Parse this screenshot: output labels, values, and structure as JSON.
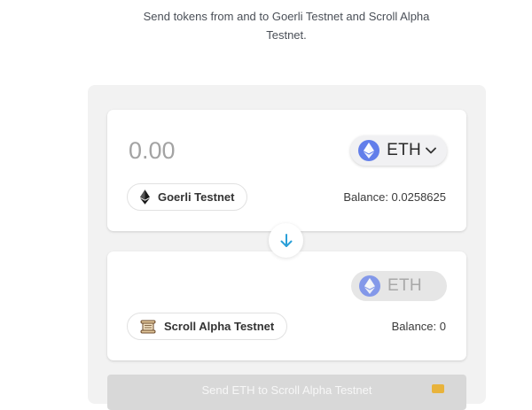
{
  "header": {
    "subtitle_line1": "Send tokens from and to Goerli Testnet and Scroll Alpha",
    "subtitle_line2": "Testnet."
  },
  "from": {
    "amount_placeholder": "0.00",
    "amount_value": "",
    "token_symbol": "ETH",
    "token_icon": "ethereum-icon",
    "network_label": "Goerli Testnet",
    "network_icon": "ethereum-icon",
    "balance_text": "Balance: 0.0258625"
  },
  "to": {
    "token_symbol": "ETH",
    "token_icon": "ethereum-icon",
    "network_label": "Scroll Alpha Testnet",
    "network_icon": "scroll-icon",
    "balance_text": "Balance: 0"
  },
  "swap": {
    "icon": "arrow-down-icon"
  },
  "actions": {
    "send_label": "Send ETH to Scroll Alpha Testnet"
  },
  "colors": {
    "eth_blue": "#627eea",
    "arrow_blue": "#2a9fd8",
    "panel_gray": "#f2f2f2",
    "disabled_button": "#d8d8d8"
  }
}
